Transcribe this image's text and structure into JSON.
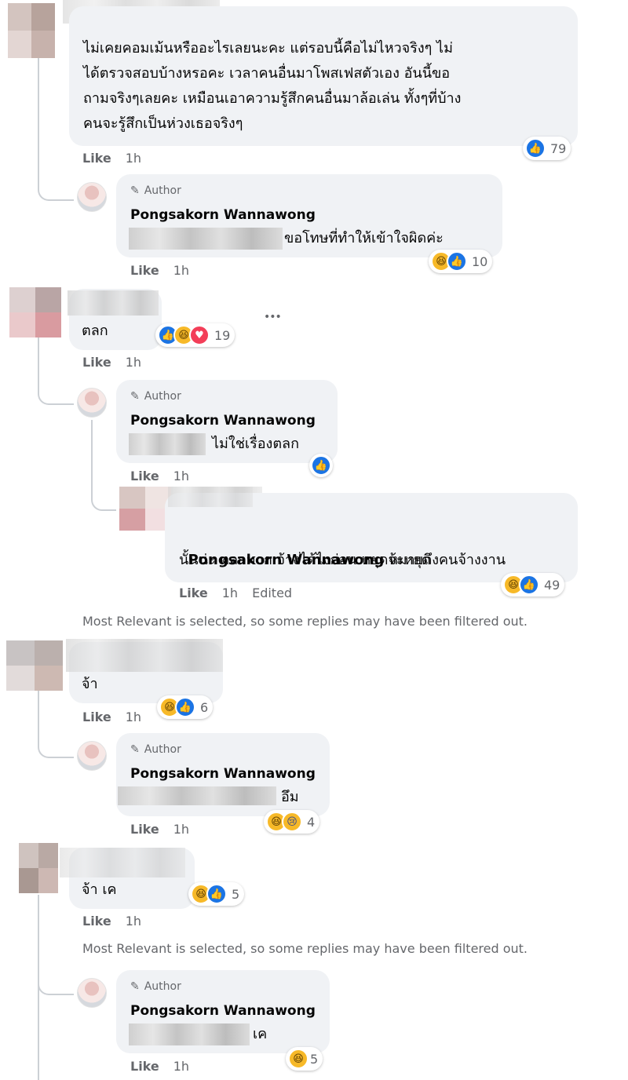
{
  "comments": {
    "c1": {
      "text": "ไม่เคยคอมเม้นหรืออะไรเลยนะคะ แต่รอบนี้คือไม่ไหวจริงๆ ไม่\nได้ตรวจสอบบ้างหรอคะ เวลาคนอื่นมาโพสเฟสตัวเอง อันนี้ขอ\nถามจริงๆเลยคะ เหมือนเอาความรู้สึกคนอื่นมาล้อเล่น ทั้งๆที่บ้าง\nคนจะรู้สึกเป็นห่วงเธอจริงๆ",
      "like": "Like",
      "time": "1h",
      "reactions": "79"
    },
    "r1": {
      "author_badge": "Author",
      "name": "Pongsakorn Wannawong",
      "text": "ขอโทษที่ทำให้เข้าใจผิดค่ะ",
      "like": "Like",
      "time": "1h",
      "reactions": "10"
    },
    "c2": {
      "text": "ตลก",
      "like": "Like",
      "time": "1h",
      "reactions": "19",
      "more": "•••"
    },
    "r2": {
      "author_badge": "Author",
      "name": "Pongsakorn Wannawong",
      "text": "ไม่ใช่เรื่องตลก",
      "like": "Like",
      "time": "1h"
    },
    "r2b": {
      "mention": "Pongsakorn Wannawong",
      "text_line1": " หมายถึงคนจ้างงาน",
      "text_line2": "นั้นน่ะ ตลกมาก จ้างได้ไงก่อน หยุดจ้ะหยุด",
      "like": "Like",
      "time": "1h",
      "edited": "Edited",
      "reactions": "49"
    },
    "filter_note_1": "Most Relevant is selected, so some replies may have been filtered out.",
    "c3": {
      "text": "จ้า",
      "like": "Like",
      "time": "1h",
      "reactions": "6"
    },
    "r3": {
      "author_badge": "Author",
      "name": "Pongsakorn Wannawong",
      "text": "อึม",
      "like": "Like",
      "time": "1h",
      "reactions": "4"
    },
    "c4": {
      "text": "จ้า เค",
      "like": "Like",
      "time": "1h",
      "reactions": "5"
    },
    "filter_note_2": "Most Relevant is selected, so some replies may have been filtered out.",
    "r4": {
      "author_badge": "Author",
      "name": "Pongsakorn Wannawong",
      "text": "เค",
      "like": "Like",
      "time": "1h",
      "reactions": "5"
    }
  },
  "colors": {
    "like": "#1b74e4",
    "haha": "#f7b928",
    "love": "#f33e58",
    "bubble": "#f0f2f5",
    "meta": "#65676b"
  }
}
